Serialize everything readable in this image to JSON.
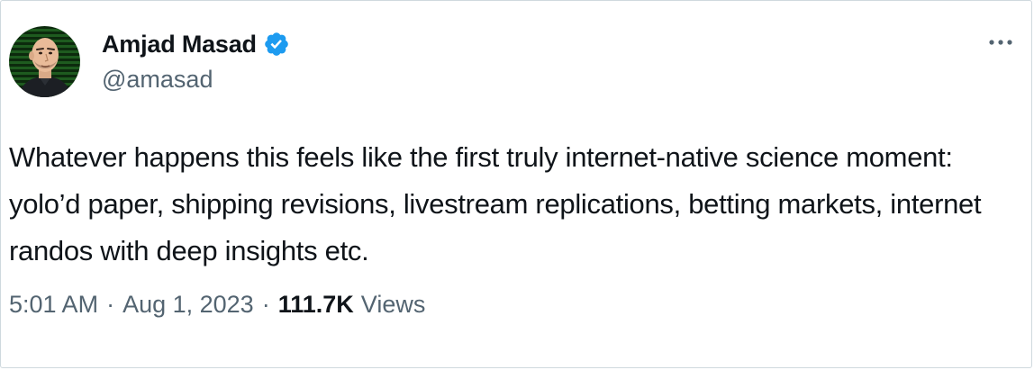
{
  "author": {
    "name": "Amjad Masad",
    "handle": "@amasad",
    "verified": true,
    "verified_color": "#1d9bf0"
  },
  "tweet": {
    "text": "Whatever happens this feels like the first truly internet-native science moment: yolo’d paper, shipping revisions, livestream replications, betting markets, internet randos with deep insights etc.",
    "time": "5:01 AM",
    "separator": "·",
    "date": "Aug 1, 2023",
    "view_count": "111.7K",
    "views_label": "Views"
  },
  "icons": {
    "more": "more-horizontal-icon",
    "verified": "verified-badge-icon",
    "avatar": "avatar-image"
  },
  "colors": {
    "text_primary": "#0f1419",
    "text_secondary": "#536471",
    "border": "#cfd9de"
  }
}
